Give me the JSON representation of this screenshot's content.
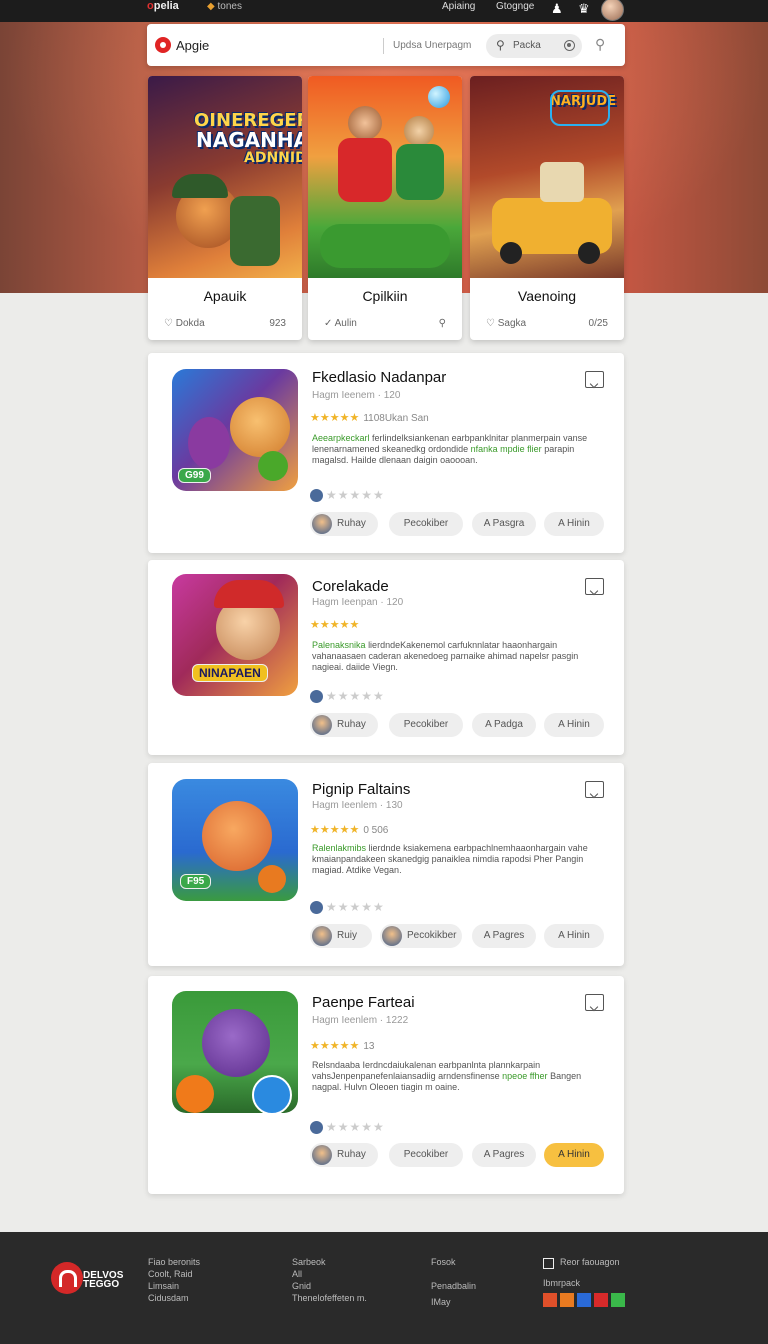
{
  "topbar": {
    "brand_left": "o",
    "brand_right": "pelia",
    "tone_icon": "",
    "tone_label": "tones",
    "link1": "Apiaing",
    "link2": "Gtognge",
    "icons": [
      "user-icon",
      "trophy-icon",
      "avatar"
    ]
  },
  "search": {
    "app_name": "Apgie",
    "hint": "Updsa Unerpagm",
    "pill_label": "Packa",
    "icons": [
      "search-icon",
      "target-icon",
      "magnifier-icon"
    ]
  },
  "featured": [
    {
      "banner_line1": "OINEREGERI",
      "banner_line2": "NAGANHAAH",
      "banner_line3": "ADNNIDAN",
      "title": "Apauik",
      "foot_left": "Dokda",
      "foot_right": "923",
      "foot_icon": "heart-icon"
    },
    {
      "title": "Cpilkiin",
      "foot_left": "Aulin",
      "foot_right": "",
      "foot_icon": "like-icon"
    },
    {
      "banner_line1": "NARJUDE",
      "title": "Vaenoing",
      "foot_left": "Sagka",
      "foot_right": "0/25",
      "foot_icon": "heart-icon"
    }
  ],
  "games": [
    {
      "title": "Fkedlasio Nadanpar",
      "subtitle": "Hagm Ieenem · 120",
      "rating": 4.5,
      "rating_text": "1108Ukan San",
      "desc_green": "Aeearpkeckarl",
      "desc_rest": "ferlindelksiankenan earbpanklnitar planmerpain vanse lenenarnamened skeanedkg ordondide",
      "desc_green2": "nfanka mpdie flier",
      "desc_tail": "parapin magalsd. Hailde dlenaan daigin oaoooan.",
      "badge": "G99",
      "tags": [
        "Ruhay",
        "Pecokiber",
        "A Pasgra",
        "A Hinin"
      ]
    },
    {
      "title": "Corelakade",
      "subtitle": "Hagm Ieenpan · 120",
      "rating": 5,
      "rating_text": "",
      "desc_green": "Palenaksnika",
      "desc_rest": "lierdndeKakenemol carfuknnlatar haaonhargain vahanaasaen caderan akenedoeg parnaike ahimad napelsr",
      "desc_green2": "",
      "desc_tail": "pasgin nagieai. daiide Viegn.",
      "badge": "NINAPAEN",
      "tags": [
        "Ruhay",
        "Pecokiber",
        "A Padga",
        "A Hinin"
      ]
    },
    {
      "title": "Pignip Faltains",
      "subtitle": "Hagm Ieenlem · 130",
      "rating": 4.5,
      "rating_text": "0 506",
      "desc_green": "Ralenlakmibs",
      "desc_rest": "lierdnde ksiakemena earbpachlnemhaaonhargain vahe kmaianpandakeen skanedgig panaiklea nimdia rapodsi Pher",
      "desc_green2": "",
      "desc_tail": "Pangin magiad. Atdike Vegan.",
      "badge": "F95",
      "tags": [
        "Ruiy",
        "Pecokikber",
        "A Pagres",
        "A Hinin"
      ]
    },
    {
      "title": "Paenpe Farteai",
      "subtitle": "Hagm Ieenlem · 1222",
      "rating": 4.5,
      "rating_text": "13",
      "desc_green": "",
      "desc_rest": "Relsndaaba Ierdncdaiukalenan earbpanlnta plannkarpain vahsJenpenpanefenlaiansadiig arndensfinense",
      "desc_green2": "npeoe ffher",
      "desc_tail": "Bangen nagpal. Hulvn Oleoen tiagin m oaine.",
      "badge": "",
      "tags": [
        "Ruhay",
        "Pecokiber",
        "A Pagres",
        "A Hinin"
      ]
    }
  ],
  "footer": {
    "brand_line1": "DELVOS",
    "brand_line2": "TEGGO",
    "col1": [
      "Fiao beronits",
      "Coolt, Raid",
      "Limsain",
      "Cidusdam"
    ],
    "col2": [
      "Sarbeok",
      "All",
      "Gnid",
      "Thenelofeffeten m."
    ],
    "col3": [
      "Fosok",
      "",
      "Penadbalin",
      "IMay"
    ],
    "col4_head": "Reor faouagon",
    "col4_sub": "Ibmrpack",
    "social_colors": [
      "#e0502a",
      "#e87a20",
      "#2a6ad8",
      "#d82a2a",
      "#3ab84a"
    ]
  }
}
